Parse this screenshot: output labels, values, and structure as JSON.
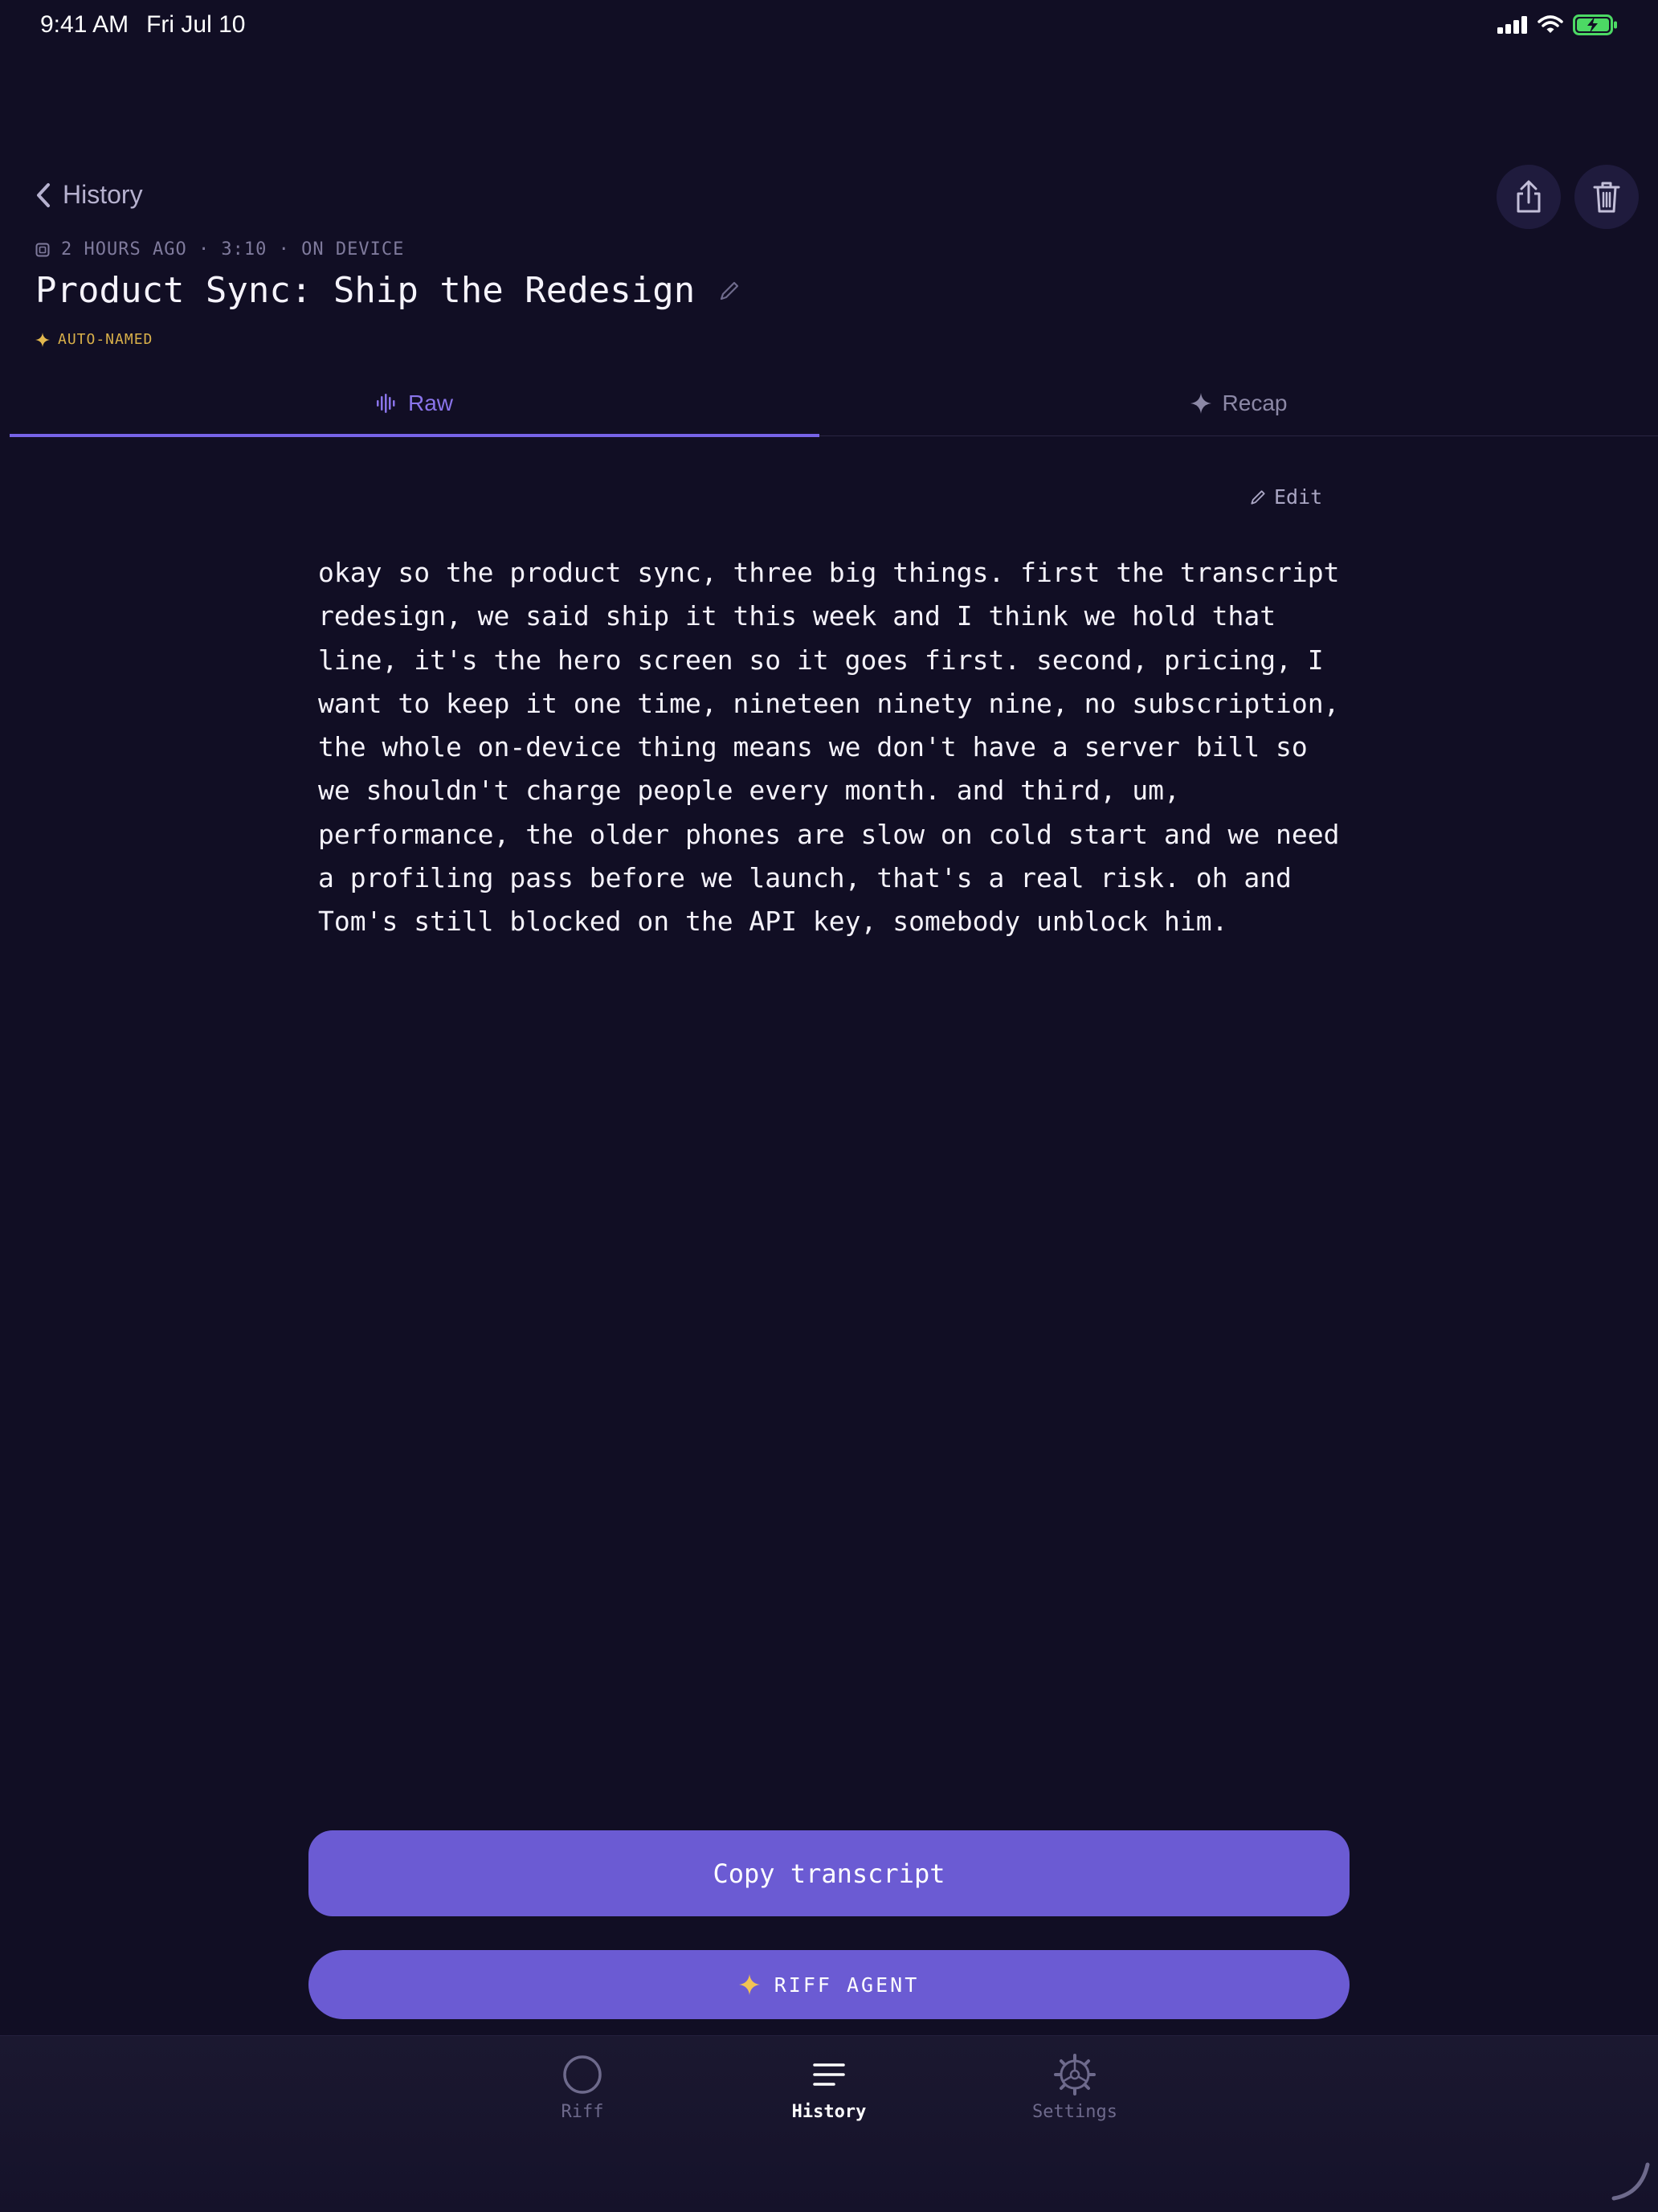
{
  "status_bar": {
    "time": "9:41 AM",
    "date": "Fri Jul 10",
    "icons": [
      "signal-icon",
      "wifi-icon",
      "battery-charging-icon"
    ]
  },
  "header": {
    "back_label": "History",
    "meta": "2 HOURS AGO · 3:10 · ON DEVICE",
    "title": "Product Sync: Ship the Redesign",
    "badge": "AUTO-NAMED",
    "actions": [
      "share-icon",
      "trash-icon"
    ]
  },
  "tabs": [
    {
      "label": "Raw",
      "icon": "waveform-icon",
      "active": true
    },
    {
      "label": "Recap",
      "icon": "sparkle-icon",
      "active": false
    }
  ],
  "content": {
    "edit_label": "Edit",
    "transcript_lines": [
      "okay so the product sync, three big things. first the transcript",
      "redesign, we said ship it this week and I think we hold that",
      "line, it's the hero screen so it goes first. second, pricing, I",
      "want to keep it one time, nineteen ninety nine, no subscription,",
      "the whole on-device thing means we don't have a server bill so",
      "we shouldn't charge people every month. and third, um,",
      "performance, the older phones are slow on cold start and we need",
      "a profiling pass before we launch, that's a real risk. oh and",
      "Tom's still blocked on the API key, somebody unblock him."
    ]
  },
  "actions": {
    "copy_label": "Copy transcript",
    "agent_label": "RIFF AGENT"
  },
  "nav": {
    "items": [
      {
        "label": "Riff",
        "icon": "circle-icon",
        "active": false
      },
      {
        "label": "History",
        "icon": "list-icon",
        "active": true
      },
      {
        "label": "Settings",
        "icon": "gear-icon",
        "active": false
      }
    ]
  },
  "colors": {
    "background": "#110e24",
    "accent": "#6b5bd3",
    "tab_active": "#8a74ea",
    "badge": "#d9b04a",
    "battery": "#4cd964"
  }
}
